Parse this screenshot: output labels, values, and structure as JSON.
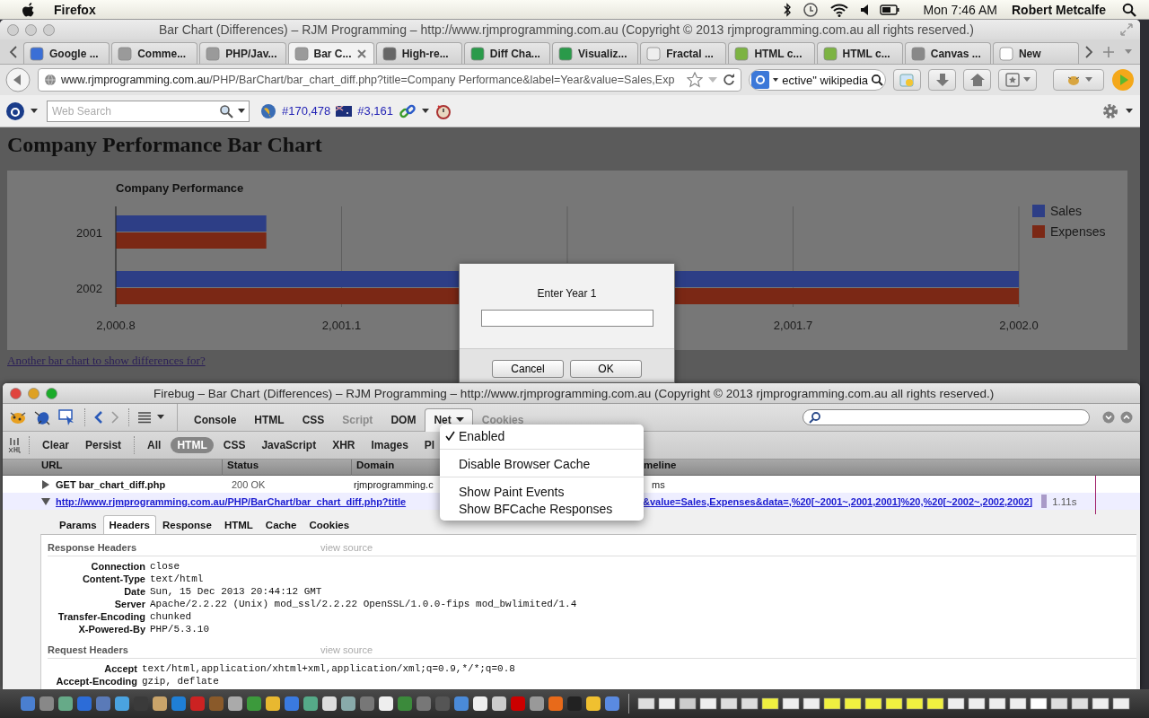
{
  "menubar": {
    "app": "Firefox",
    "clock": "Mon 7:46 AM",
    "user": "Robert Metcalfe"
  },
  "browser": {
    "title": "Bar Chart (Differences) – RJM Programming – http://www.rjmprogramming.com.au (Copyright © 2013 rjmprogramming.com.au all rights reserved.)",
    "tabs": [
      {
        "label": "Google ...",
        "selected": false
      },
      {
        "label": "Comme...",
        "selected": false
      },
      {
        "label": "PHP/Jav...",
        "selected": false
      },
      {
        "label": "Bar C...",
        "selected": true
      },
      {
        "label": "High-re...",
        "selected": false
      },
      {
        "label": "Diff Cha...",
        "selected": false
      },
      {
        "label": "Visualiz...",
        "selected": false
      },
      {
        "label": "Fractal ...",
        "selected": false
      },
      {
        "label": "HTML c...",
        "selected": false
      },
      {
        "label": "HTML c...",
        "selected": false
      },
      {
        "label": "Canvas ...",
        "selected": false
      },
      {
        "label": "New",
        "selected": false
      }
    ],
    "address": {
      "host": "www.rjmprogramming.com.au",
      "path": "/PHP/BarChart/bar_chart_diff.php?title=Company Performance&label=Year&value=Sales,Exp"
    },
    "search_value": "ective\" wikipedia",
    "web_search_placeholder": "Web Search",
    "rank_global": "#170,478",
    "rank_country": "#3,161"
  },
  "page": {
    "heading": "Company Performance Bar Chart",
    "chart_data": {
      "type": "bar",
      "orientation": "horizontal",
      "title": "Company Performance",
      "categories": [
        "2001",
        "2002"
      ],
      "series": [
        {
          "name": "Sales",
          "color": "#2d3e86",
          "values": [
            2001,
            2002
          ]
        },
        {
          "name": "Expenses",
          "color": "#7b2815",
          "values": [
            2001,
            2002
          ]
        }
      ],
      "legend": "right",
      "xlim": [
        2000.8,
        2002.0
      ],
      "xticks": [
        {
          "value": 2000.8,
          "label": "2,000.8"
        },
        {
          "value": 2001.1,
          "label": "2,001.1"
        },
        {
          "value": 2001.7,
          "label": "2,001.7"
        },
        {
          "value": 2002.0,
          "label": "2,002.0"
        }
      ]
    },
    "link": "Another bar chart to show differences for?"
  },
  "dialog": {
    "prompt": "Enter Year 1",
    "buttons": [
      "Cancel",
      "OK"
    ]
  },
  "firebug": {
    "title": "Firebug – Bar Chart (Differences) – RJM Programming – http://www.rjmprogramming.com.au (Copyright © 2013 rjmprogramming.com.au all rights reserved.)",
    "panels": [
      {
        "label": "Console",
        "selected": false,
        "disabled": false,
        "has_menu": false
      },
      {
        "label": "HTML",
        "selected": false,
        "disabled": false,
        "has_menu": false
      },
      {
        "label": "CSS",
        "selected": false,
        "disabled": false,
        "has_menu": false
      },
      {
        "label": "Script",
        "selected": false,
        "disabled": true,
        "has_menu": false
      },
      {
        "label": "DOM",
        "selected": false,
        "disabled": false,
        "has_menu": false
      },
      {
        "label": "Net",
        "selected": true,
        "disabled": false,
        "has_menu": true
      },
      {
        "label": "Cookies",
        "selected": false,
        "disabled": true,
        "has_menu": false
      }
    ],
    "actions": [
      "Clear",
      "Persist"
    ],
    "filters": [
      {
        "label": "All",
        "selected": false
      },
      {
        "label": "HTML",
        "selected": true
      },
      {
        "label": "CSS",
        "selected": false
      },
      {
        "label": "JavaScript",
        "selected": false
      },
      {
        "label": "XHR",
        "selected": false
      },
      {
        "label": "Images",
        "selected": false
      },
      {
        "label": "Pl",
        "selected": false
      }
    ],
    "columns": [
      "URL",
      "Status",
      "Domain",
      "meline"
    ],
    "requests": [
      {
        "kind": "summary",
        "expanded": false,
        "name": "GET bar_chart_diff.php",
        "status": "200 OK",
        "domain": "rjmprogramming.c",
        "timeline": "ms"
      },
      {
        "kind": "url",
        "expanded": true,
        "url_start": "http://www.rjmprogramming.com.au/PHP/BarChart/bar_chart_diff.php?title",
        "url_end": "&value=Sales,Expenses&data=,%20[~2001~,2001,2001]%20,%20[~2002~,2002,2002]",
        "time": "1.11s"
      }
    ],
    "request_tabs": [
      {
        "label": "Params",
        "selected": false
      },
      {
        "label": "Headers",
        "selected": true
      },
      {
        "label": "Response",
        "selected": false
      },
      {
        "label": "HTML",
        "selected": false
      },
      {
        "label": "Cache",
        "selected": false
      },
      {
        "label": "Cookies",
        "selected": false
      }
    ],
    "sections": [
      {
        "title": "Response Headers",
        "view_source": "view source",
        "rows": [
          {
            "name": "Connection",
            "value": "close"
          },
          {
            "name": "Content-Type",
            "value": "text/html"
          },
          {
            "name": "Date",
            "value": "Sun, 15 Dec 2013 20:44:12 GMT"
          },
          {
            "name": "Server",
            "value": "Apache/2.2.22 (Unix) mod_ssl/2.2.22 OpenSSL/1.0.0-fips mod_bwlimited/1.4"
          },
          {
            "name": "Transfer-Encoding",
            "value": "chunked"
          },
          {
            "name": "X-Powered-By",
            "value": "PHP/5.3.10"
          }
        ]
      },
      {
        "title": "Request Headers",
        "view_source": "view source",
        "rows": [
          {
            "name": "Accept",
            "value": "text/html,application/xhtml+xml,application/xml;q=0.9,*/*;q=0.8"
          },
          {
            "name": "Accept-Encoding",
            "value": "gzip, deflate"
          }
        ]
      }
    ],
    "net_menu": [
      {
        "kind": "item",
        "label": "Enabled",
        "checked": true
      },
      {
        "kind": "separator"
      },
      {
        "kind": "item",
        "label": "Disable Browser Cache",
        "checked": false
      },
      {
        "kind": "separator"
      },
      {
        "kind": "item",
        "label": "Show Paint Events",
        "checked": false
      },
      {
        "kind": "item",
        "label": "Show BFCache Responses",
        "checked": false
      }
    ]
  }
}
